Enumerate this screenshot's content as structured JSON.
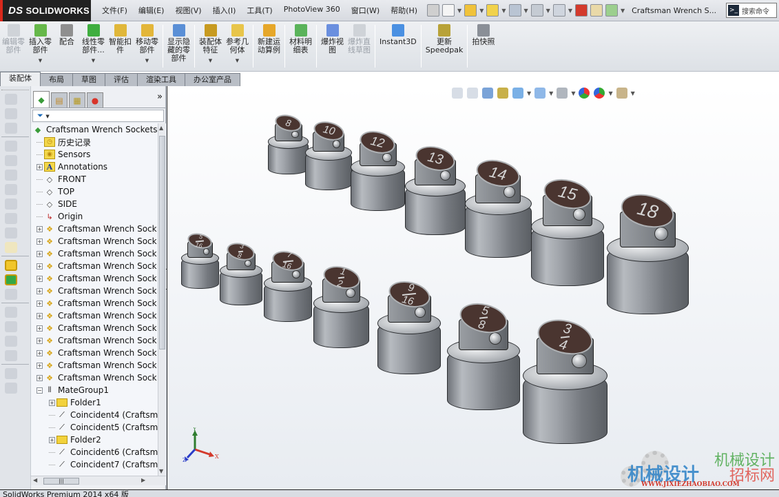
{
  "app": {
    "logo": "SOLIDWORKS",
    "logo_mark": "DS",
    "document_title": "Craftsman Wrench S...",
    "search_placeholder": "搜索命令"
  },
  "menu": [
    "文件(F)",
    "编辑(E)",
    "视图(V)",
    "插入(I)",
    "工具(T)",
    "PhotoView 360",
    "窗口(W)",
    "帮助(H)"
  ],
  "quick_access": [
    {
      "name": "pin-icon",
      "dropdown": false
    },
    {
      "name": "new-document-icon",
      "dropdown": true
    },
    {
      "name": "open-folder-icon",
      "dropdown": true
    },
    {
      "name": "rebuild-warning-icon",
      "dropdown": true
    },
    {
      "name": "print-icon",
      "dropdown": true
    },
    {
      "name": "undo-icon",
      "dropdown": true
    },
    {
      "name": "select-pointer-icon",
      "dropdown": true
    },
    {
      "name": "traffic-light-icon",
      "dropdown": false
    },
    {
      "name": "file-properties-icon",
      "dropdown": false
    },
    {
      "name": "options-list-icon",
      "dropdown": true
    }
  ],
  "commands": [
    {
      "label": "编辑零\n部件",
      "icon": "edit-component-icon",
      "disabled": true,
      "dropdown": false
    },
    {
      "label": "插入零\n部件",
      "icon": "insert-component-icon",
      "disabled": false,
      "dropdown": true
    },
    {
      "label": "配合",
      "icon": "mate-paperclip-icon",
      "disabled": false,
      "dropdown": false
    },
    {
      "label": "线性零\n部件...",
      "icon": "linear-pattern-icon",
      "disabled": false,
      "dropdown": true
    },
    {
      "label": "智能扣\n件",
      "icon": "smart-fasteners-icon",
      "disabled": false,
      "dropdown": false
    },
    {
      "label": "移动零\n部件",
      "icon": "move-component-icon",
      "disabled": false,
      "dropdown": true
    },
    {
      "sep": true
    },
    {
      "label": "显示隐\n藏的零\n部件",
      "icon": "show-hidden-components-icon",
      "disabled": false,
      "dropdown": false
    },
    {
      "sep": true
    },
    {
      "label": "装配体\n特征",
      "icon": "assembly-features-icon",
      "disabled": false,
      "dropdown": true
    },
    {
      "label": "参考几\n何体",
      "icon": "reference-geometry-icon",
      "disabled": false,
      "dropdown": true
    },
    {
      "sep": true
    },
    {
      "label": "新建运\n动算例",
      "icon": "new-motion-study-icon",
      "disabled": false,
      "dropdown": false
    },
    {
      "sep": true
    },
    {
      "label": "材料明\n细表",
      "icon": "bill-of-materials-icon",
      "disabled": false,
      "dropdown": false
    },
    {
      "sep": true
    },
    {
      "label": "爆炸视\n图",
      "icon": "exploded-view-icon",
      "disabled": false,
      "dropdown": false
    },
    {
      "label": "爆炸直\n线草图",
      "icon": "explode-line-sketch-icon",
      "disabled": true,
      "dropdown": false
    },
    {
      "sep": true
    },
    {
      "label": "Instant3D",
      "icon": "instant3d-icon",
      "disabled": false,
      "dropdown": false
    },
    {
      "sep": true
    },
    {
      "label": "更新\nSpeedpak",
      "icon": "update-speedpak-icon",
      "disabled": false,
      "dropdown": false
    },
    {
      "sep": true
    },
    {
      "label": "拍快照",
      "icon": "take-snapshot-icon",
      "disabled": false,
      "dropdown": false
    }
  ],
  "tabs": [
    {
      "label": "装配体",
      "active": true
    },
    {
      "label": "布局",
      "active": false
    },
    {
      "label": "草图",
      "active": false
    },
    {
      "label": "评估",
      "active": false
    },
    {
      "label": "渲染工具",
      "active": false
    },
    {
      "label": "办公室产品",
      "active": false
    }
  ],
  "feature_manager": {
    "more": "»",
    "filter_icon": "▼",
    "tree": [
      {
        "label": "Craftsman Wrench Sockets",
        "icon": "assembly-icon",
        "level": 0,
        "expander": "none"
      },
      {
        "label": "历史记录",
        "icon": "history-icon",
        "level": 1,
        "expander": "none"
      },
      {
        "label": "Sensors",
        "icon": "sensors-icon",
        "level": 1,
        "expander": "none"
      },
      {
        "label": "Annotations",
        "icon": "annotations-icon",
        "level": 1,
        "expander": "plus"
      },
      {
        "label": "FRONT",
        "icon": "plane-icon",
        "level": 1,
        "expander": "none"
      },
      {
        "label": "TOP",
        "icon": "plane-icon",
        "level": 1,
        "expander": "none"
      },
      {
        "label": "SIDE",
        "icon": "plane-icon",
        "level": 1,
        "expander": "none"
      },
      {
        "label": "Origin",
        "icon": "origin-icon",
        "level": 1,
        "expander": "none"
      },
      {
        "label": "Craftsman Wrench Sock",
        "icon": "part-icon",
        "level": 1,
        "expander": "plus"
      },
      {
        "label": "Craftsman Wrench Sock",
        "icon": "part-icon",
        "level": 1,
        "expander": "plus"
      },
      {
        "label": "Craftsman Wrench Sock",
        "icon": "part-icon",
        "level": 1,
        "expander": "plus"
      },
      {
        "label": "Craftsman Wrench Sock",
        "icon": "part-icon",
        "level": 1,
        "expander": "plus"
      },
      {
        "label": "Craftsman Wrench Sock",
        "icon": "part-icon",
        "level": 1,
        "expander": "plus"
      },
      {
        "label": "Craftsman Wrench Sock",
        "icon": "part-icon",
        "level": 1,
        "expander": "plus"
      },
      {
        "label": "Craftsman Wrench Sock",
        "icon": "part-icon",
        "level": 1,
        "expander": "plus"
      },
      {
        "label": "Craftsman Wrench Sock",
        "icon": "part-icon",
        "level": 1,
        "expander": "plus"
      },
      {
        "label": "Craftsman Wrench Sock",
        "icon": "part-icon",
        "level": 1,
        "expander": "plus"
      },
      {
        "label": "Craftsman Wrench Sock",
        "icon": "part-icon",
        "level": 1,
        "expander": "plus"
      },
      {
        "label": "Craftsman Wrench Sock",
        "icon": "part-icon",
        "level": 1,
        "expander": "plus"
      },
      {
        "label": "Craftsman Wrench Sock",
        "icon": "part-icon",
        "level": 1,
        "expander": "plus"
      },
      {
        "label": "Craftsman Wrench Sock",
        "icon": "part-icon",
        "level": 1,
        "expander": "plus"
      },
      {
        "label": "MateGroup1",
        "icon": "mates-icon",
        "level": 1,
        "expander": "minus"
      },
      {
        "label": "Folder1",
        "icon": "folder-icon",
        "level": 2,
        "expander": "plus"
      },
      {
        "label": "Coincident4 (Craftsm",
        "icon": "coincident-icon",
        "level": 2,
        "expander": "none"
      },
      {
        "label": "Coincident5 (Craftsm",
        "icon": "coincident-icon",
        "level": 2,
        "expander": "none"
      },
      {
        "label": "Folder2",
        "icon": "folder-icon",
        "level": 2,
        "expander": "plus"
      },
      {
        "label": "Coincident6 (Craftsm",
        "icon": "coincident-icon",
        "level": 2,
        "expander": "none"
      },
      {
        "label": "Coincident7 (Craftsm",
        "icon": "coincident-icon",
        "level": 2,
        "expander": "none"
      }
    ]
  },
  "heads_up_toolbar": [
    {
      "name": "zoom-to-fit-icon",
      "dropdown": false
    },
    {
      "name": "zoom-to-area-icon",
      "dropdown": false
    },
    {
      "name": "previous-view-icon",
      "dropdown": false
    },
    {
      "name": "section-view-icon",
      "dropdown": false
    },
    {
      "name": "view-orientation-icon",
      "dropdown": true
    },
    {
      "name": "display-style-icon",
      "dropdown": true
    },
    {
      "name": "hide-show-items-icon",
      "dropdown": true
    },
    {
      "name": "edit-appearance-icon",
      "dropdown": false
    },
    {
      "name": "apply-scene-icon",
      "dropdown": true
    },
    {
      "name": "view-settings-icon",
      "dropdown": true
    }
  ],
  "model": {
    "back_row_sizes": [
      "8",
      "10",
      "12",
      "13",
      "14",
      "15",
      "18"
    ],
    "front_row_sizes": [
      {
        "num": "5",
        "den": "16"
      },
      {
        "num": "3",
        "den": "8"
      },
      {
        "num": "7",
        "den": "16"
      },
      {
        "num": "1",
        "den": "2"
      },
      {
        "num": "9",
        "den": "16"
      },
      {
        "num": "5",
        "den": "8"
      },
      {
        "num": "3",
        "den": "4"
      }
    ]
  },
  "triad": {
    "x": "X",
    "y": "Y",
    "z": "Z"
  },
  "watermark": {
    "line1": "机械设计",
    "line2": "机械设计",
    "line3": "招标网",
    "url": "WWW.JIXIEZHAOBIAO.COM"
  },
  "statusbar": {
    "text": "SolidWorks Premium 2014 x64 版"
  }
}
